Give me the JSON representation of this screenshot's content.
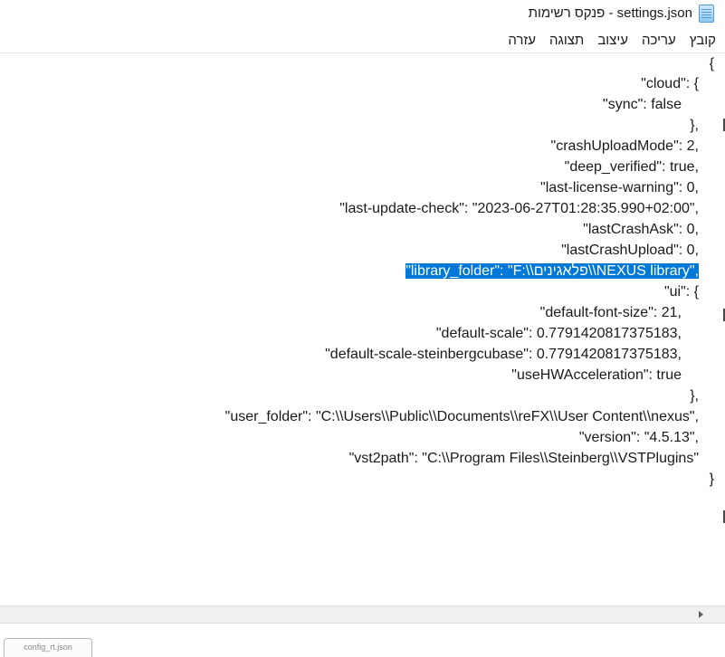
{
  "window": {
    "title": "settings.json - פנקס רשימות",
    "icon": "notepad-icon"
  },
  "menu": [
    "קובץ",
    "עריכה",
    "עיצוב",
    "תצוגה",
    "עזרה"
  ],
  "editor": {
    "lines": [
      "{",
      "\"cloud\": {",
      "\"sync\": false",
      "},",
      "\"crashUploadMode\": 2,",
      "\"deep_verified\": true,",
      "\"last-license-warning\": 0,",
      "\"last-update-check\": \"2023-06-27T01:28:35.990+02:00\",",
      "\"lastCrashAsk\": 0,",
      "\"lastCrashUpload\": 0,",
      "\"library_folder\": \"F:\\\\פלאגינים\\\\NEXUS library\",",
      "\"ui\": {",
      "\"default-font-size\": 21,",
      "\"default-scale\": 0.7791420817375183,",
      "\"default-scale-steinbergcubase\": 0.7791420817375183,",
      "\"useHWAcceleration\": true",
      "},",
      "\"user_folder\": \"C:\\\\Users\\\\Public\\\\Documents\\\\reFX\\\\User Content\\\\nexus\",",
      "\"version\": \"4.5.13\",",
      "\"vst2path\": \"C:\\\\Program Files\\\\Steinberg\\\\VSTPlugins\"",
      "}"
    ],
    "selected_line": 10
  },
  "taskbar": {
    "thumbnail_label": "config_rt.json"
  }
}
